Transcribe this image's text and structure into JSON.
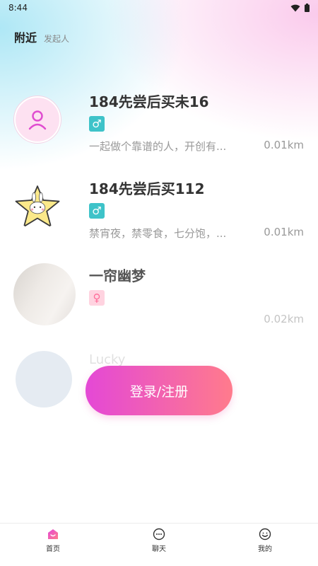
{
  "status_bar": {
    "time": "8:44"
  },
  "header": {
    "active_tab": "附近",
    "other_tab": "发起人"
  },
  "users": [
    {
      "name": "184先尝后买未16",
      "gender": "♂",
      "bio": "一起做个靠谱的人，开创有...",
      "distance": "0.01km"
    },
    {
      "name": "184先尝后买112",
      "gender": "♂",
      "bio": "禁宵夜，禁零食，七分饱，...",
      "distance": "0.01km"
    },
    {
      "name": "一帘幽梦",
      "gender": "♀",
      "bio": "",
      "distance": "0.02km"
    }
  ],
  "ghost_user": {
    "name": "Lucky"
  },
  "login_button": {
    "label": "登录/注册"
  },
  "tabbar": [
    {
      "label": "首页",
      "icon": "home-icon"
    },
    {
      "label": "聊天",
      "icon": "chat-icon"
    },
    {
      "label": "我的",
      "icon": "profile-icon"
    }
  ],
  "colors": {
    "accent_start": "#e448d6",
    "accent_end": "#ff7b8c",
    "male": "#3ec3c9",
    "female": "#ff6b98"
  }
}
